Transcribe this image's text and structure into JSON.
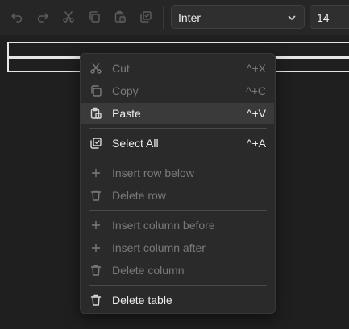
{
  "toolbar": {
    "buttons": [
      {
        "name": "undo-icon"
      },
      {
        "name": "redo-icon"
      },
      {
        "name": "cut-icon"
      },
      {
        "name": "copy-icon"
      },
      {
        "name": "paste-icon"
      },
      {
        "name": "select-all-icon"
      }
    ],
    "font_family": "Inter",
    "font_size": "14"
  },
  "context_menu": {
    "items": [
      {
        "label": "Cut",
        "shortcut": "^+X",
        "icon": "scissors-icon",
        "enabled": false
      },
      {
        "label": "Copy",
        "shortcut": "^+C",
        "icon": "copy-icon",
        "enabled": false
      },
      {
        "label": "Paste",
        "shortcut": "^+V",
        "icon": "paste-icon",
        "enabled": true,
        "highlighted": true
      },
      {
        "label": "Select All",
        "shortcut": "^+A",
        "icon": "select-all-icon",
        "enabled": true
      },
      {
        "label": "Insert row below",
        "shortcut": "",
        "icon": "plus-icon",
        "enabled": false
      },
      {
        "label": "Delete row",
        "shortcut": "",
        "icon": "trash-icon",
        "enabled": false
      },
      {
        "label": "Insert column before",
        "shortcut": "",
        "icon": "plus-icon",
        "enabled": false
      },
      {
        "label": "Insert column after",
        "shortcut": "",
        "icon": "plus-icon",
        "enabled": false
      },
      {
        "label": "Delete column",
        "shortcut": "",
        "icon": "trash-icon",
        "enabled": false
      },
      {
        "label": "Delete table",
        "shortcut": "",
        "icon": "trash-icon",
        "enabled": true
      }
    ]
  },
  "colors": {
    "background": "#1f1f1f",
    "menu_background": "#2a2a2a",
    "highlight": "#3a3a3a",
    "enabled_text": "#ececec",
    "disabled_text": "#7a7a7a"
  }
}
